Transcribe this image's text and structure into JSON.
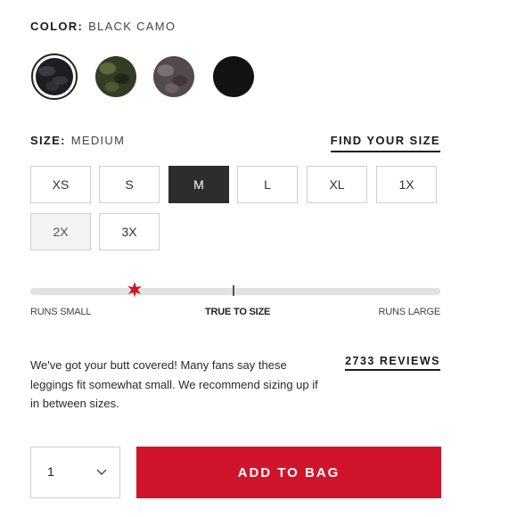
{
  "color": {
    "label": "COLOR:",
    "selected": "BLACK CAMO",
    "swatches": [
      {
        "icon": "black-camo-swatch",
        "hex": "#1c1e23"
      },
      {
        "icon": "green-camo-swatch",
        "hex": "#333d26"
      },
      {
        "icon": "grey-camo-swatch",
        "hex": "#524a4e"
      },
      {
        "icon": "black-swatch",
        "hex": "#121212"
      }
    ]
  },
  "size": {
    "label": "SIZE:",
    "selected": "MEDIUM",
    "find_link": "FIND YOUR SIZE",
    "options": [
      "XS",
      "S",
      "M",
      "L",
      "XL",
      "1X",
      "2X",
      "3X"
    ]
  },
  "fit": {
    "left": "RUNS SMALL",
    "middle": "TRUE TO SIZE",
    "right": "RUNS LARGE",
    "marker_color": "#d0142c",
    "note": "We've got your butt covered! Many fans say these leggings fit somewhat small. We recommend sizing up if in between sizes.",
    "reviews_link": "2733 REVIEWS"
  },
  "cart": {
    "quantity": "1",
    "add_label": "ADD TO BAG",
    "accent": "#d0142c"
  }
}
